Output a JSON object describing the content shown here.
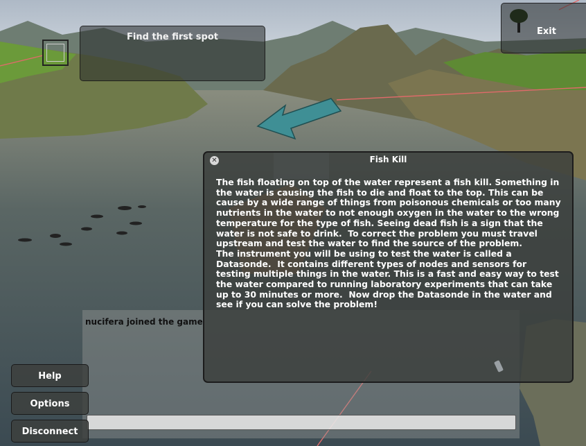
{
  "hud": {
    "objective": "Find the first spot",
    "exit_label": "Exit"
  },
  "dialog": {
    "close_icon": "close-icon",
    "title": "Fish Kill",
    "body": "The fish floating on top of the water represent a fish kill. Something in the water is causing the fish to die and float to the top. This can be cause by a wide range of things from poisonous chemicals or too many nutrients in the water to not enough oxygen in the water to the wrong temperature for the type of fish. Seeing dead fish is a sign that the water is not safe to drink.  To correct the problem you must travel upstream and test the water to find the source of the problem.\nThe instrument you will be using to test the water is called a Datasonde.  It contains different types of nodes and sensors for testing multiple things in the water. This is a fast and easy way to test the water compared to running laboratory experiments that can take up to 30 minutes or more.  Now drop the Datasonde in the water and see if you can solve the problem!"
  },
  "chat": {
    "message": "nucifera joined the game",
    "input_value": ""
  },
  "menu": {
    "help": "Help",
    "options": "Options",
    "disconnect": "Disconnect"
  },
  "colors": {
    "arrow": "#3f8f95",
    "water": "#4a5a5f",
    "grass": "#5e8a34",
    "pointer_line": "#e06a6a"
  }
}
